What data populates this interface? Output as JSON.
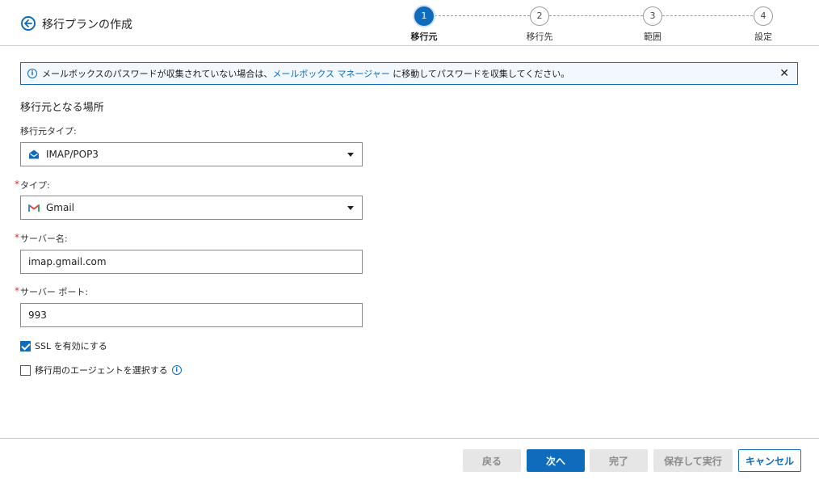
{
  "header": {
    "title": "移行プランの作成",
    "steps": [
      {
        "number": "1",
        "label": "移行元",
        "active": true
      },
      {
        "number": "2",
        "label": "移行先",
        "active": false
      },
      {
        "number": "3",
        "label": "範囲",
        "active": false
      },
      {
        "number": "4",
        "label": "設定",
        "active": false
      }
    ]
  },
  "banner": {
    "text_before": "メールボックスのパスワードが収集されていない場合は、",
    "link": "メールボックス マネージャー",
    "text_after": " に移動してパスワードを収集してください。",
    "close": "✕"
  },
  "form": {
    "section_title": "移行元となる場所",
    "source_type": {
      "label": "移行元タイプ:",
      "value": "IMAP/POP3"
    },
    "type": {
      "label": "タイプ:",
      "value": "Gmail",
      "required": "*"
    },
    "server_name": {
      "label": "サーバー名:",
      "value": "imap.gmail.com",
      "required": "*"
    },
    "server_port": {
      "label": "サーバー ポート:",
      "value": "993",
      "required": "*"
    },
    "ssl": {
      "label": "SSL を有効にする",
      "checked": true
    },
    "agent": {
      "label": "移行用のエージェントを選択する",
      "checked": false
    }
  },
  "footer": {
    "back": "戻る",
    "next": "次へ",
    "finish": "完了",
    "save_run": "保存して実行",
    "cancel": "キャンセル"
  },
  "colors": {
    "accent": "#0f6cbd",
    "required": "#d13438",
    "gmail_red": "#ea4335"
  }
}
